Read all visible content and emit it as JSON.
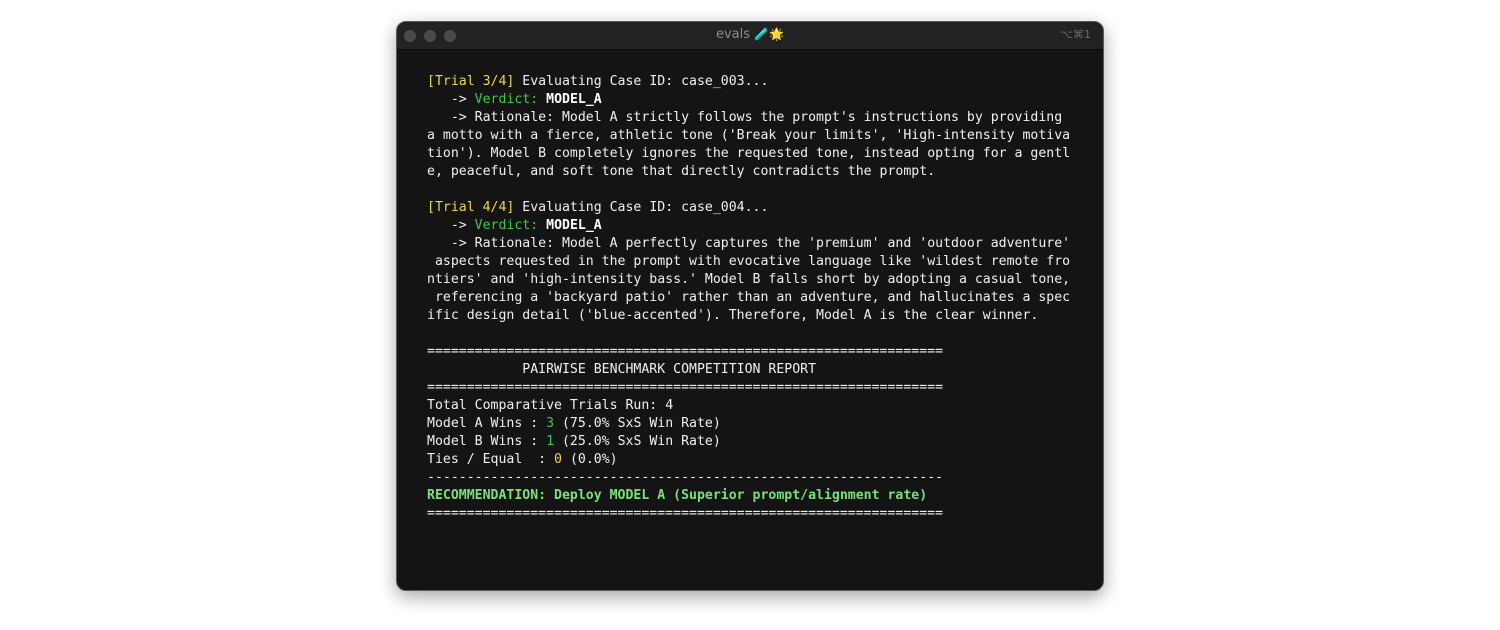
{
  "window": {
    "title": "evals",
    "title_emojis": "🧪🌟",
    "shortcut": "⌥⌘1"
  },
  "trials": [
    {
      "tag": "[Trial 3/4]",
      "heading": " Evaluating Case ID: case_003...",
      "arrow_indent": "   -> ",
      "verdict_label": "Verdict:",
      "verdict_value": "MODEL_A",
      "rationale_lines": [
        "   -> Rationale: Model A strictly follows the prompt's instructions by providing",
        "a motto with a fierce, athletic tone ('Break your limits', 'High-intensity motiva",
        "tion'). Model B completely ignores the requested tone, instead opting for a gentl",
        "e, peaceful, and soft tone that directly contradicts the prompt."
      ]
    },
    {
      "tag": "[Trial 4/4]",
      "heading": " Evaluating Case ID: case_004...",
      "arrow_indent": "   -> ",
      "verdict_label": "Verdict:",
      "verdict_value": "MODEL_A",
      "rationale_lines": [
        "   -> Rationale: Model A perfectly captures the 'premium' and 'outdoor adventure'",
        " aspects requested in the prompt with evocative language like 'wildest remote fro",
        "ntiers' and 'high-intensity bass.' Model B falls short by adopting a casual tone,",
        " referencing a 'backyard patio' rather than an adventure, and hallucinates a spec",
        "ific design detail ('blue-accented'). Therefore, Model A is the clear winner."
      ]
    }
  ],
  "report": {
    "rule_double": "=================================================================",
    "rule_single": "-----------------------------------------------------------------",
    "title": "            PAIRWISE BENCHMARK COMPETITION REPORT",
    "total_label": "Total Comparative Trials Run: ",
    "total_value": "4",
    "model_a_label": "Model A Wins : ",
    "model_a_value": "3",
    "model_a_rate": " (75.0% SxS Win Rate)",
    "model_b_label": "Model B Wins : ",
    "model_b_value": "1",
    "model_b_rate": " (25.0% SxS Win Rate)",
    "ties_label": "Ties / Equal  : ",
    "ties_value": "0",
    "ties_rate": " (0.0%)",
    "recommendation": "RECOMMENDATION: Deploy MODEL A (Superior prompt/alignment rate)"
  }
}
